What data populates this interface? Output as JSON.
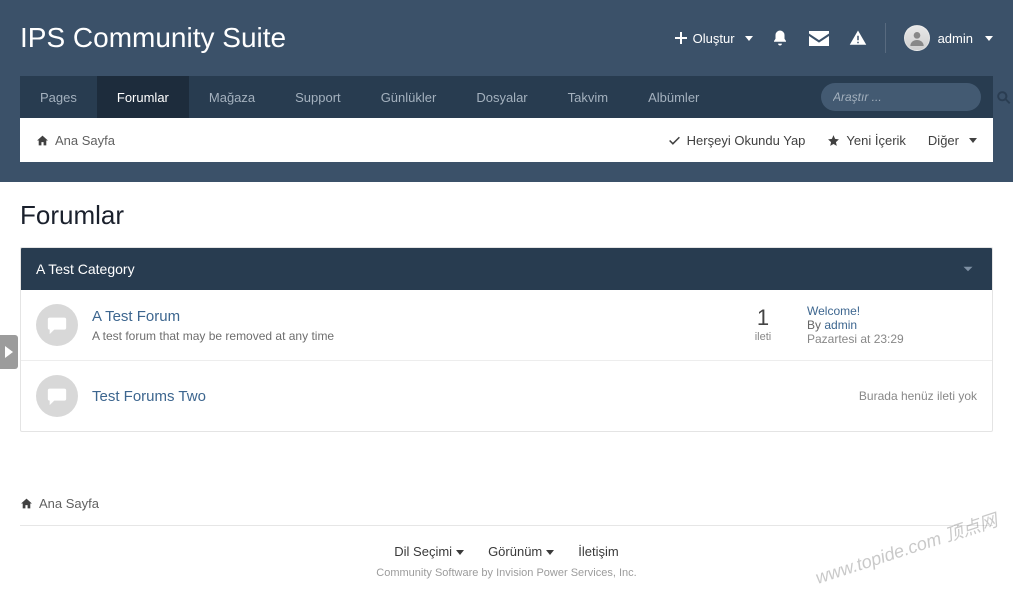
{
  "site": {
    "title": "IPS Community Suite"
  },
  "header": {
    "create_label": "Oluştur",
    "user_name": "admin"
  },
  "nav": {
    "items": [
      {
        "label": "Pages",
        "active": false
      },
      {
        "label": "Forumlar",
        "active": true
      },
      {
        "label": "Mağaza",
        "active": false
      },
      {
        "label": "Support",
        "active": false
      },
      {
        "label": "Günlükler",
        "active": false
      },
      {
        "label": "Dosyalar",
        "active": false
      },
      {
        "label": "Takvim",
        "active": false
      },
      {
        "label": "Albümler",
        "active": false
      }
    ],
    "search_placeholder": "Araştır ..."
  },
  "breadcrumb": {
    "home": "Ana Sayfa"
  },
  "tools": {
    "mark_read": "Herşeyi Okundu Yap",
    "new_content": "Yeni İçerik",
    "more": "Diğer"
  },
  "page": {
    "heading": "Forumlar"
  },
  "category": {
    "title": "A Test Category",
    "forums": [
      {
        "title": "A Test Forum",
        "desc": "A test forum that may be removed at any time",
        "posts_count": "1",
        "posts_label": "ileti",
        "last": {
          "title": "Welcome!",
          "by_prefix": "By",
          "author": "admin",
          "time": "Pazartesi at 23:29"
        }
      },
      {
        "title": "Test Forums Two",
        "empty_text": "Burada henüz ileti yok"
      }
    ]
  },
  "footer": {
    "lang": "Dil Seçimi",
    "view": "Görünüm",
    "contact": "İletişim",
    "copyright": "Community Software by Invision Power Services, Inc."
  },
  "watermark": "www.topide.com 顶点网"
}
